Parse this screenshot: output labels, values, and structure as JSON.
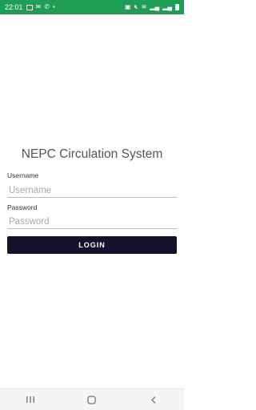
{
  "status_bar": {
    "time": "22:01",
    "icons_left": [
      "sim-icon",
      "mail-icon",
      "phone-icon",
      "dot-icon"
    ],
    "icons_right": [
      "alarm-icon",
      "mute-icon",
      "wifi-icon",
      "signal-icon",
      "signal-icon",
      "battery-icon"
    ],
    "color": "#1f9d55"
  },
  "login": {
    "title": "NEPC Circulation System",
    "username_label": "Username",
    "username_placeholder": "Username",
    "password_label": "Password",
    "password_placeholder": "Password",
    "login_button": "LOGIN",
    "button_color": "#14132b"
  },
  "nav_bar": {
    "buttons": [
      "recent-apps-icon",
      "home-icon",
      "back-icon"
    ]
  }
}
